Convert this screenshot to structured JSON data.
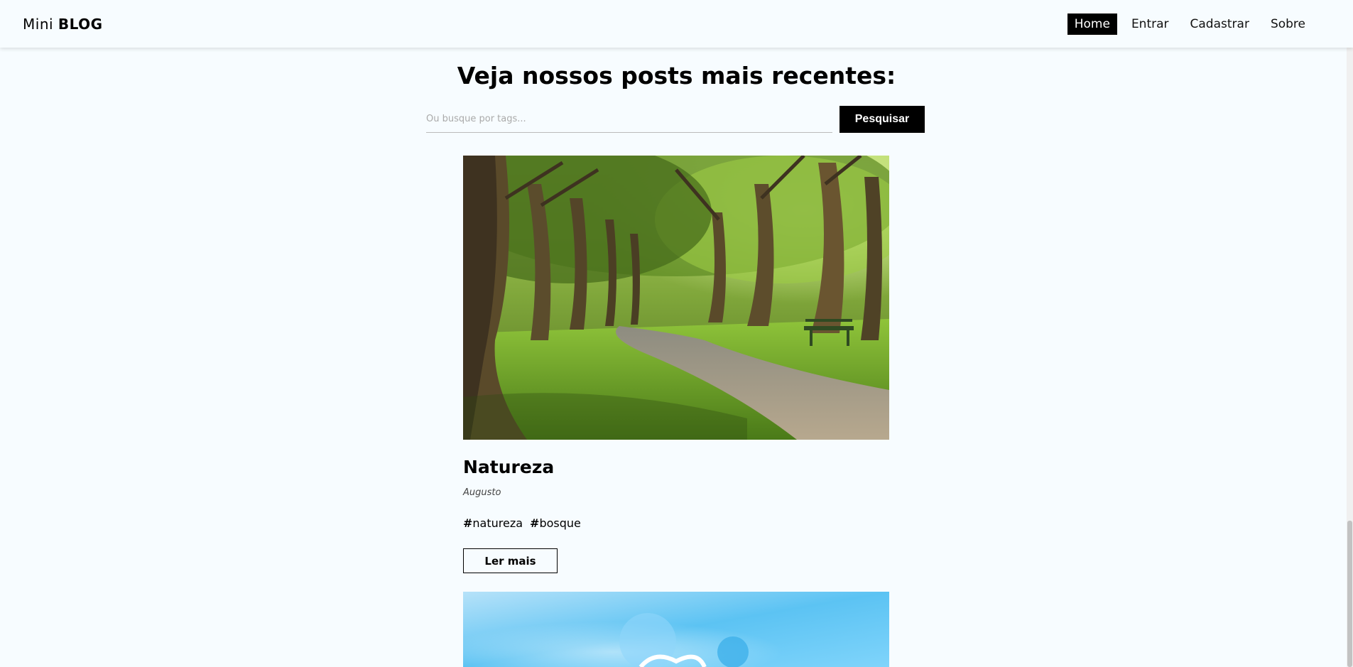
{
  "navbar": {
    "brand_light": "Mini",
    "brand_bold": "BLOG",
    "links": [
      {
        "label": "Home",
        "active": true
      },
      {
        "label": "Entrar",
        "active": false
      },
      {
        "label": "Cadastrar",
        "active": false
      },
      {
        "label": "Sobre",
        "active": false
      }
    ]
  },
  "main": {
    "title": "Veja nossos posts mais recentes:",
    "search": {
      "placeholder": "Ou busque por tags...",
      "button_label": "Pesquisar"
    },
    "posts": [
      {
        "title": "Natureza",
        "author": "Augusto",
        "tags": [
          "natureza",
          "bosque"
        ],
        "read_more_label": "Ler mais"
      }
    ]
  },
  "colors": {
    "background": "#f7fcff",
    "accent": "#000000"
  }
}
